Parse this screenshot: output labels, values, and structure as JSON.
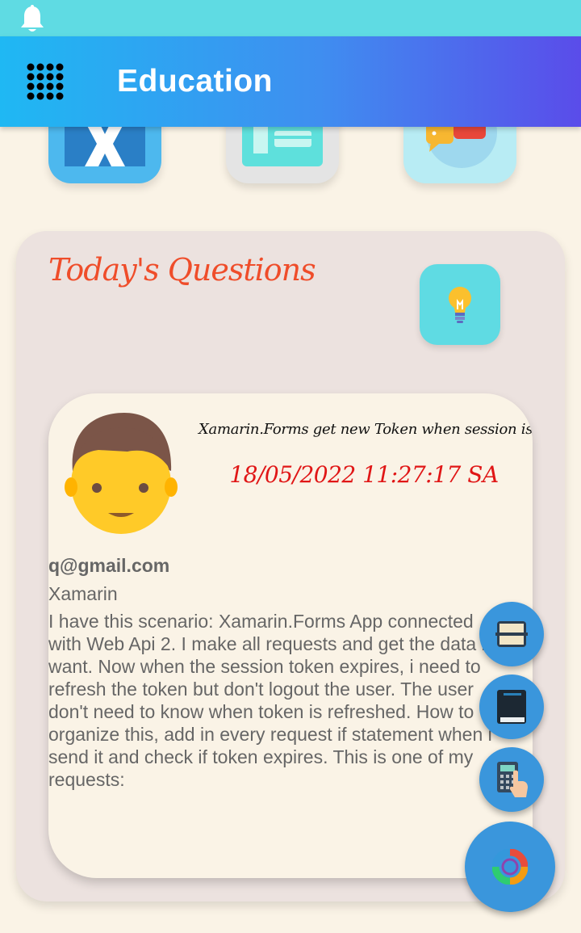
{
  "app_bar": {
    "title": "Education",
    "menu_icon": "grid-menu-icon",
    "notification_icon": "bell-icon"
  },
  "tiles": [
    {
      "name": "xamarin-tile",
      "icon": "xamarin-logo-icon"
    },
    {
      "name": "news-tile",
      "icon": "newspaper-icon"
    },
    {
      "name": "chat-tile",
      "icon": "chat-bubbles-icon"
    }
  ],
  "questions_card": {
    "heading": "Today's Questions",
    "idea_icon": "lightbulb-icon"
  },
  "question": {
    "title": "Xamarin.Forms get new Token when session is over",
    "date": "18/05/2022 11:27:17 SA",
    "email": "q@gmail.com",
    "tag": "Xamarin",
    "body": "I have this scenario: Xamarin.Forms App connected with Web Api 2. I make all requests and get the data i want. Now when the session token expires, i need to refresh the token but don't logout the user. The user don't need to know when token is refreshed. How to organize this, add in every request if statement when i send it and check if token expires. This is one of my requests:",
    "avatar_icon": "user-avatar-icon"
  },
  "fabs": {
    "scanner_icon": "scanner-icon",
    "book_icon": "book-icon",
    "calculator_icon": "calculator-icon",
    "main_icon": "colorful-ring-icon"
  },
  "colors": {
    "status_bar": "#5fdbe3",
    "app_bar_start": "#1fb8f3",
    "app_bar_end": "#5a4cea",
    "page_background": "#faf3e6",
    "heading": "#ef4d2a",
    "date": "#e01616",
    "fab": "#3a96dc"
  }
}
